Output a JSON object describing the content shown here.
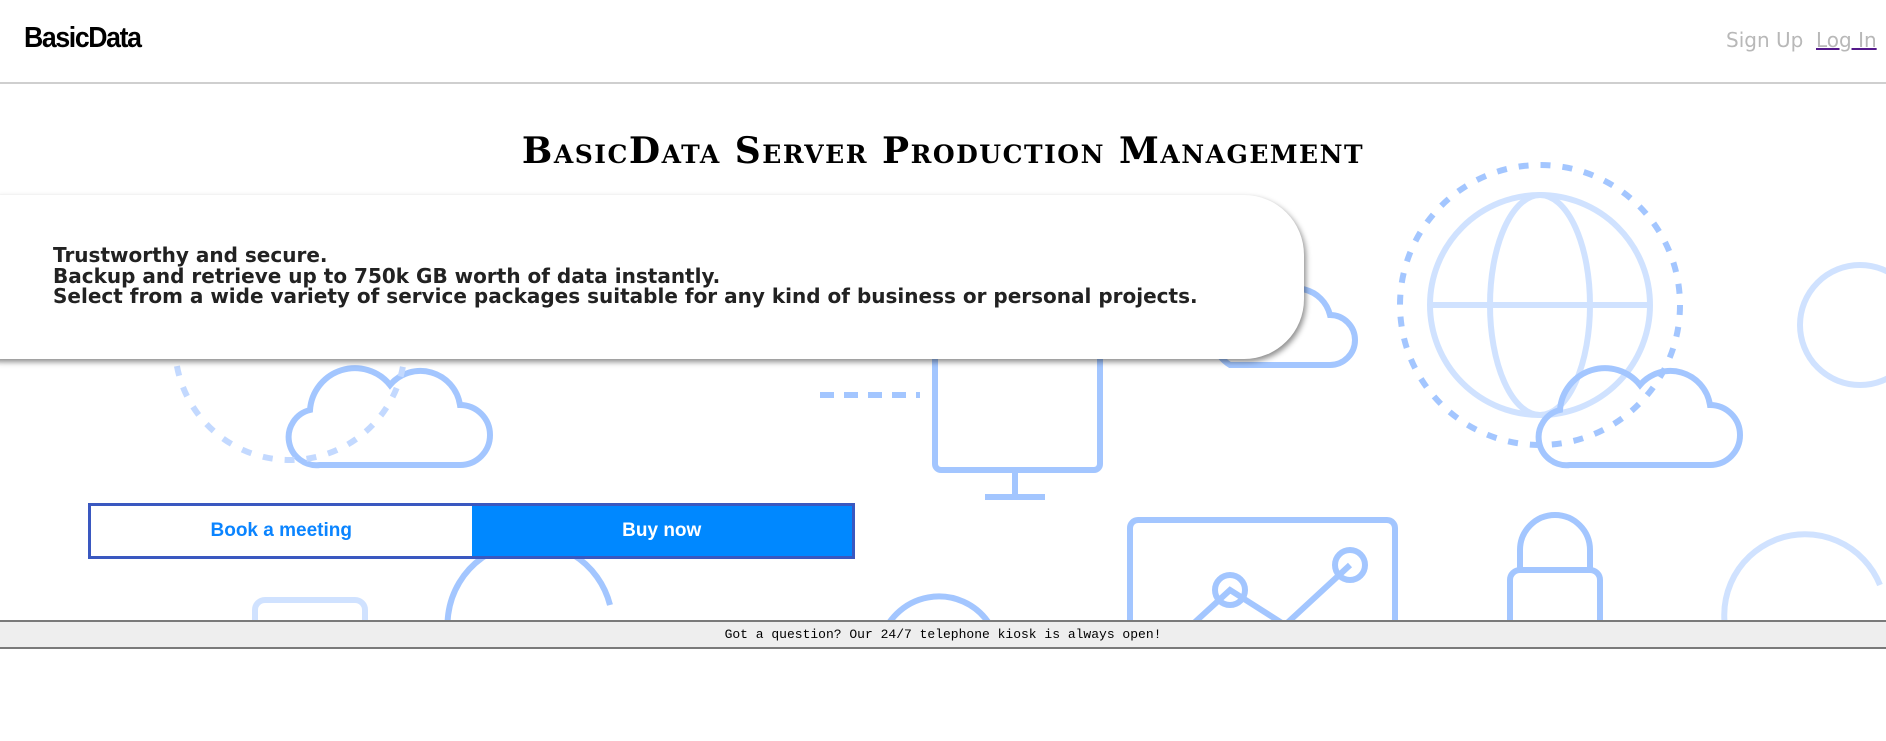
{
  "header": {
    "logo": "BasicData",
    "nav": {
      "signup": "Sign Up",
      "login": "Log In"
    }
  },
  "hero": {
    "title": "BasicData Server Production Management",
    "lines": [
      "Trustworthy and secure.",
      "Backup and retrieve up to 750k GB worth of data instantly.",
      "Select from a wide variety of service packages suitable for any kind of business or personal projects."
    ],
    "buttons": {
      "book": "Book a meeting",
      "buy": "Buy now"
    }
  },
  "banner": {
    "text": "Got a question? Our 24/7 telephone kiosk is always open!"
  },
  "colors": {
    "accent": "#0088ff",
    "border": "#3a58c0",
    "icons": "#7fb0ff"
  }
}
